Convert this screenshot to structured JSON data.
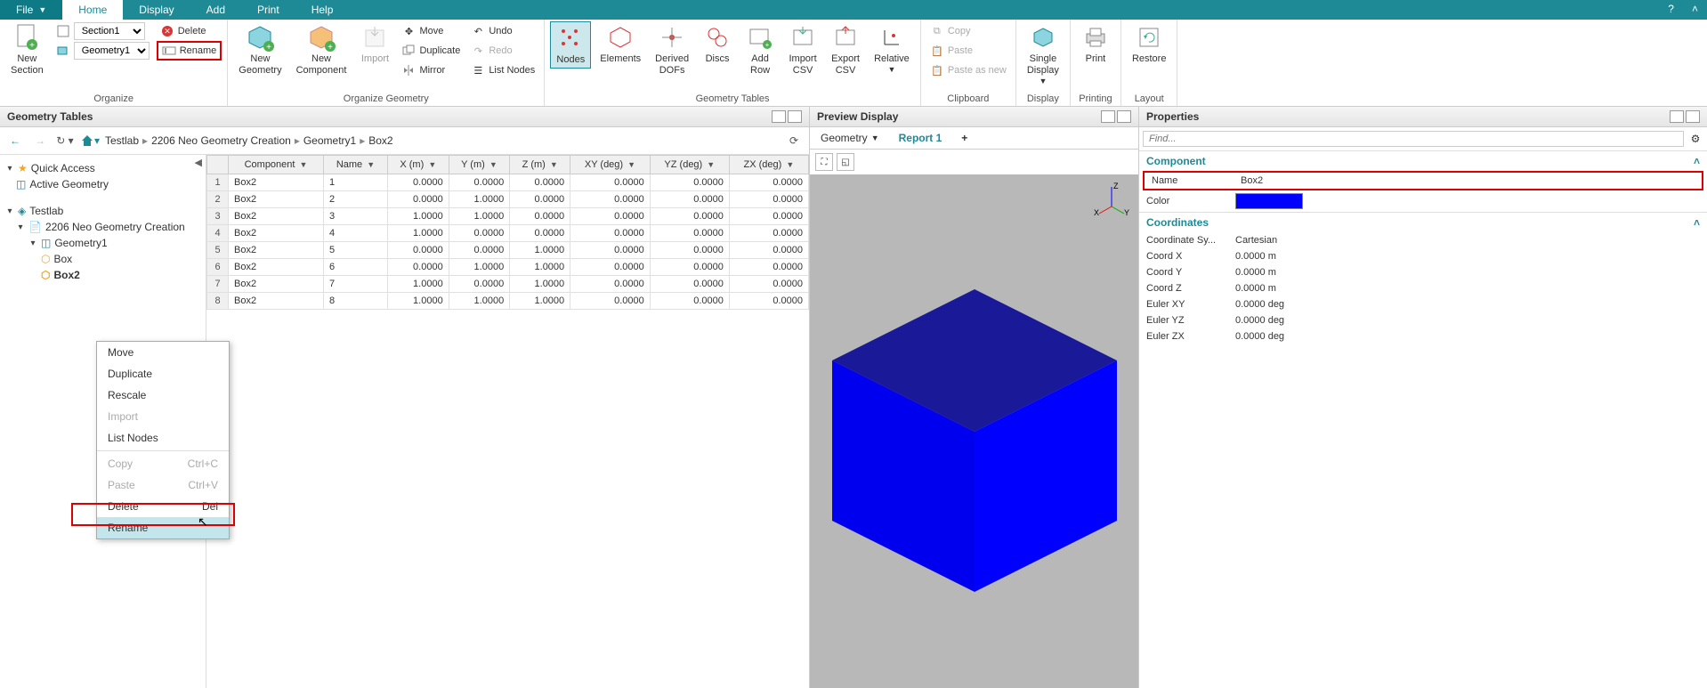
{
  "menu": {
    "file": "File",
    "home": "Home",
    "display": "Display",
    "add": "Add",
    "print": "Print",
    "help": "Help"
  },
  "ribbon": {
    "organize": {
      "label": "Organize",
      "new_section": "New\nSection",
      "section_sel": "Section1",
      "geometry_sel": "Geometry1",
      "delete": "Delete",
      "rename": "Rename"
    },
    "organize_geometry": {
      "label": "Organize Geometry",
      "new_geometry": "New\nGeometry",
      "new_component": "New\nComponent",
      "import": "Import",
      "move": "Move",
      "duplicate": "Duplicate",
      "mirror": "Mirror",
      "undo": "Undo",
      "redo": "Redo",
      "list_nodes": "List Nodes"
    },
    "geometry_tables": {
      "label": "Geometry Tables",
      "nodes": "Nodes",
      "elements": "Elements",
      "derived_dofs": "Derived\nDOFs",
      "discs": "Discs",
      "add_row": "Add\nRow",
      "import_csv": "Import\nCSV",
      "export_csv": "Export\nCSV",
      "relative": "Relative"
    },
    "clipboard": {
      "label": "Clipboard",
      "copy": "Copy",
      "paste": "Paste",
      "paste_as_new": "Paste as new"
    },
    "display": {
      "label": "Display",
      "single_display": "Single\nDisplay"
    },
    "printing": {
      "label": "Printing",
      "print": "Print"
    },
    "layout": {
      "label": "Layout",
      "restore": "Restore"
    }
  },
  "panels": {
    "geometry_tables": "Geometry Tables",
    "preview_display": "Preview Display",
    "properties": "Properties"
  },
  "breadcrumb": {
    "items": [
      "Testlab",
      "2206 Neo Geometry Creation",
      "Geometry1",
      "Box2"
    ]
  },
  "tree": {
    "quick_access": "Quick Access",
    "active_geometry": "Active Geometry",
    "testlab": "Testlab",
    "project": "2206 Neo Geometry Creation",
    "geometry1": "Geometry1",
    "box": "Box",
    "box2": "Box2"
  },
  "table": {
    "headers": [
      "Component",
      "Name",
      "X (m)",
      "Y (m)",
      "Z (m)",
      "XY (deg)",
      "YZ (deg)",
      "ZX (deg)"
    ],
    "rows": [
      {
        "n": 1,
        "comp": "Box2",
        "name": "1",
        "x": "0.0000",
        "y": "0.0000",
        "z": "0.0000",
        "xy": "0.0000",
        "yz": "0.0000",
        "zx": "0.0000"
      },
      {
        "n": 2,
        "comp": "Box2",
        "name": "2",
        "x": "0.0000",
        "y": "1.0000",
        "z": "0.0000",
        "xy": "0.0000",
        "yz": "0.0000",
        "zx": "0.0000"
      },
      {
        "n": 3,
        "comp": "Box2",
        "name": "3",
        "x": "1.0000",
        "y": "1.0000",
        "z": "0.0000",
        "xy": "0.0000",
        "yz": "0.0000",
        "zx": "0.0000"
      },
      {
        "n": 4,
        "comp": "Box2",
        "name": "4",
        "x": "1.0000",
        "y": "0.0000",
        "z": "0.0000",
        "xy": "0.0000",
        "yz": "0.0000",
        "zx": "0.0000"
      },
      {
        "n": 5,
        "comp": "Box2",
        "name": "5",
        "x": "0.0000",
        "y": "0.0000",
        "z": "1.0000",
        "xy": "0.0000",
        "yz": "0.0000",
        "zx": "0.0000"
      },
      {
        "n": 6,
        "comp": "Box2",
        "name": "6",
        "x": "0.0000",
        "y": "1.0000",
        "z": "1.0000",
        "xy": "0.0000",
        "yz": "0.0000",
        "zx": "0.0000"
      },
      {
        "n": 7,
        "comp": "Box2",
        "name": "7",
        "x": "1.0000",
        "y": "0.0000",
        "z": "1.0000",
        "xy": "0.0000",
        "yz": "0.0000",
        "zx": "0.0000"
      },
      {
        "n": 8,
        "comp": "Box2",
        "name": "8",
        "x": "1.0000",
        "y": "1.0000",
        "z": "1.0000",
        "xy": "0.0000",
        "yz": "0.0000",
        "zx": "0.0000"
      }
    ]
  },
  "context_menu": {
    "move": "Move",
    "duplicate": "Duplicate",
    "rescale": "Rescale",
    "import": "Import",
    "list_nodes": "List Nodes",
    "copy": "Copy",
    "copy_sc": "Ctrl+C",
    "paste": "Paste",
    "paste_sc": "Ctrl+V",
    "delete": "Delete",
    "delete_sc": "Del",
    "rename": "Rename"
  },
  "preview": {
    "geometry_tab": "Geometry",
    "report_tab": "Report 1",
    "axis": {
      "x": "X",
      "y": "Y",
      "z": "Z"
    }
  },
  "properties": {
    "find_placeholder": "Find...",
    "component_hdr": "Component",
    "name_label": "Name",
    "name_value": "Box2",
    "color_label": "Color",
    "color_value": "#0000ff",
    "coordinates_hdr": "Coordinates",
    "coord_sys_label": "Coordinate Sy...",
    "coord_sys_value": "Cartesian",
    "coord_x_label": "Coord X",
    "coord_x_value": "0.0000 m",
    "coord_y_label": "Coord Y",
    "coord_y_value": "0.0000 m",
    "coord_z_label": "Coord Z",
    "coord_z_value": "0.0000 m",
    "euler_xy_label": "Euler XY",
    "euler_xy_value": "0.0000 deg",
    "euler_yz_label": "Euler YZ",
    "euler_yz_value": "0.0000 deg",
    "euler_zx_label": "Euler ZX",
    "euler_zx_value": "0.0000 deg"
  }
}
